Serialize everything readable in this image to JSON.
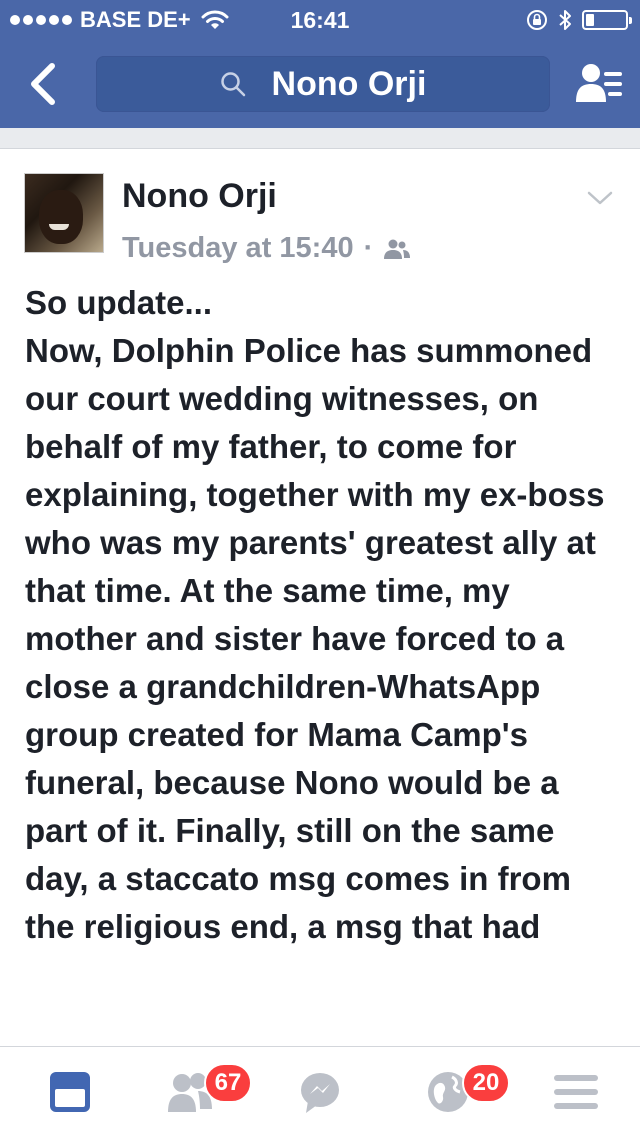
{
  "status_bar": {
    "carrier": "BASE DE+",
    "time": "16:41",
    "battery_level": 0.2
  },
  "header": {
    "search_text": "Nono Orji",
    "icons": [
      "back-chevron-icon",
      "search-icon",
      "friend-requests-icon"
    ]
  },
  "post": {
    "author": "Nono Orji",
    "timestamp": "Tuesday at 15:40",
    "separator": "·",
    "body": "So update...\nNow, Dolphin Police has summoned our court wedding witnesses, on behalf of my father, to come for explaining, together with my ex-boss who was my parents' greatest ally at that time. At the same time, my mother and sister have forced to a close a grandchildren-WhatsApp group created for Mama Camp's funeral, because Nono would be a part of it. Finally, still on the same day, a staccato msg comes in from the religious end, a msg that had"
  },
  "tabbar": {
    "friends_badge": "67",
    "notifications_badge": "20"
  },
  "colors": {
    "header_blue": "#4a67a8",
    "search_field": "#3b5b9a",
    "active_tab": "#4267b2",
    "inactive_tab": "#bcc0c8",
    "badge_red": "#fa3e3e"
  }
}
